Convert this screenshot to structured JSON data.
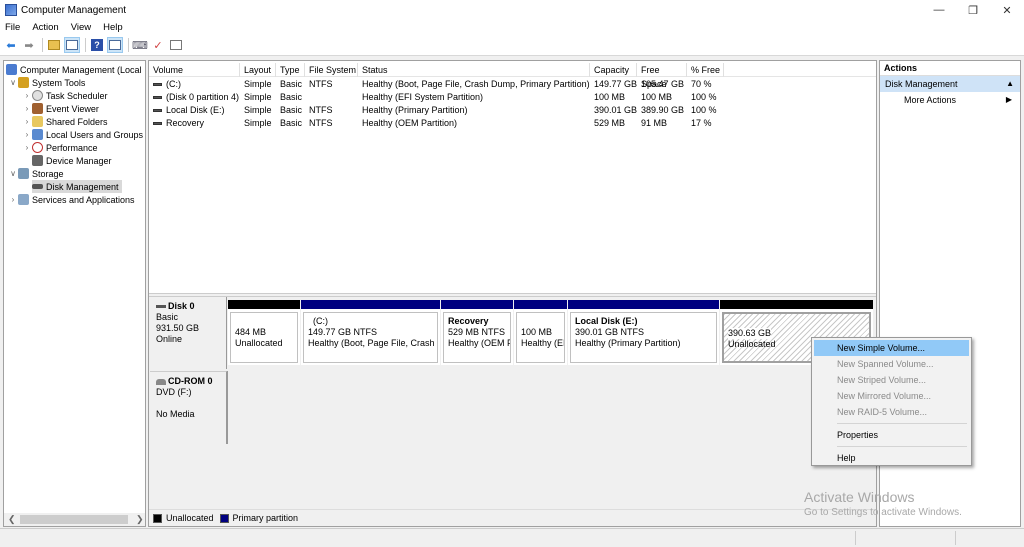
{
  "window": {
    "title": "Computer Management",
    "controls": [
      "minimize",
      "restore",
      "close"
    ]
  },
  "menu": [
    "File",
    "Action",
    "View",
    "Help"
  ],
  "toolbar": [
    "back-icon",
    "forward-icon",
    "up-folder-icon",
    "show-hide-tree-icon",
    "help-icon",
    "show-hide-action-pane-icon",
    "connect-icon",
    "check-icon",
    "properties-icon"
  ],
  "tree": {
    "root": "Computer Management (Local",
    "items": [
      {
        "label": "System Tools",
        "level": 1,
        "expander": "expanded",
        "icon": "tools-icon"
      },
      {
        "label": "Task Scheduler",
        "level": 2,
        "expander": "collapsed",
        "icon": "clock-icon"
      },
      {
        "label": "Event Viewer",
        "level": 2,
        "expander": "collapsed",
        "icon": "event-viewer-icon"
      },
      {
        "label": "Shared Folders",
        "level": 2,
        "expander": "collapsed",
        "icon": "shared-folder-icon"
      },
      {
        "label": "Local Users and Groups",
        "level": 2,
        "expander": "collapsed",
        "icon": "users-icon"
      },
      {
        "label": "Performance",
        "level": 2,
        "expander": "collapsed",
        "icon": "performance-icon"
      },
      {
        "label": "Device Manager",
        "level": 2,
        "expander": "none",
        "icon": "device-manager-icon"
      },
      {
        "label": "Storage",
        "level": 1,
        "expander": "expanded",
        "icon": "storage-icon"
      },
      {
        "label": "Disk Management",
        "level": 2,
        "expander": "none",
        "icon": "disk-icon",
        "selected": true
      },
      {
        "label": "Services and Applications",
        "level": 1,
        "expander": "collapsed",
        "icon": "services-icon"
      }
    ]
  },
  "volume_table": {
    "columns": [
      "Volume",
      "Layout",
      "Type",
      "File System",
      "Status",
      "Capacity",
      "Free Space",
      "% Free"
    ],
    "rows": [
      {
        "volume": "(C:)",
        "layout": "Simple",
        "type": "Basic",
        "fs": "NTFS",
        "status": "Healthy (Boot, Page File, Crash Dump, Primary Partition)",
        "capacity": "149.77 GB",
        "free": "105.47 GB",
        "pct": "70 %"
      },
      {
        "volume": "(Disk 0 partition 4)",
        "layout": "Simple",
        "type": "Basic",
        "fs": "",
        "status": "Healthy (EFI System Partition)",
        "capacity": "100 MB",
        "free": "100 MB",
        "pct": "100 %"
      },
      {
        "volume": "Local Disk (E:)",
        "layout": "Simple",
        "type": "Basic",
        "fs": "NTFS",
        "status": "Healthy (Primary Partition)",
        "capacity": "390.01 GB",
        "free": "389.90 GB",
        "pct": "100 %"
      },
      {
        "volume": "Recovery",
        "layout": "Simple",
        "type": "Basic",
        "fs": "NTFS",
        "status": "Healthy (OEM Partition)",
        "capacity": "529 MB",
        "free": "91 MB",
        "pct": "17 %"
      }
    ]
  },
  "disks": [
    {
      "name": "Disk 0",
      "type": "Basic",
      "size": "931.50 GB",
      "state": "Online",
      "partitions": [
        {
          "title": "",
          "line1": "484 MB",
          "line2": "Unallocated",
          "kind": "unallocated"
        },
        {
          "title": "(C:)",
          "line1": "149.77 GB NTFS",
          "line2": "Healthy (Boot, Page File, Crash D",
          "kind": "primary"
        },
        {
          "title": "Recovery",
          "line1": "529 MB NTFS",
          "line2": "Healthy (OEM F",
          "kind": "primary"
        },
        {
          "title": "",
          "line1": "100 MB",
          "line2": "Healthy (EI",
          "kind": "primary"
        },
        {
          "title": "Local Disk  (E:)",
          "line1": "390.01 GB NTFS",
          "line2": "Healthy (Primary Partition)",
          "kind": "primary"
        },
        {
          "title": "",
          "line1": "390.63 GB",
          "line2": "Unallocated",
          "kind": "unallocated",
          "selected": true
        }
      ]
    },
    {
      "name": "CD-ROM 0",
      "type": "DVD (F:)",
      "state": "No Media"
    }
  ],
  "legend": [
    {
      "label": "Unallocated",
      "color": "#000000"
    },
    {
      "label": "Primary partition",
      "color": "#000080"
    }
  ],
  "actions": {
    "header": "Actions",
    "section": "Disk Management",
    "items": [
      "More Actions"
    ]
  },
  "context_menu": {
    "items": [
      {
        "label": "New Simple Volume...",
        "state": "highlighted"
      },
      {
        "label": "New Spanned Volume...",
        "state": "disabled"
      },
      {
        "label": "New Striped Volume...",
        "state": "disabled"
      },
      {
        "label": "New Mirrored Volume...",
        "state": "disabled"
      },
      {
        "label": "New RAID-5 Volume...",
        "state": "disabled"
      },
      {
        "separator": true
      },
      {
        "label": "Properties",
        "state": "enabled"
      },
      {
        "separator": true
      },
      {
        "label": "Help",
        "state": "enabled"
      }
    ]
  },
  "watermark": {
    "line1": "Activate Windows",
    "line2": "Go to Settings to activate Windows."
  },
  "colors": {
    "primary_partition": "#000080",
    "unallocated": "#000000",
    "selection_highlight": "#91c9f7",
    "action_section": "#cfe3f7"
  }
}
